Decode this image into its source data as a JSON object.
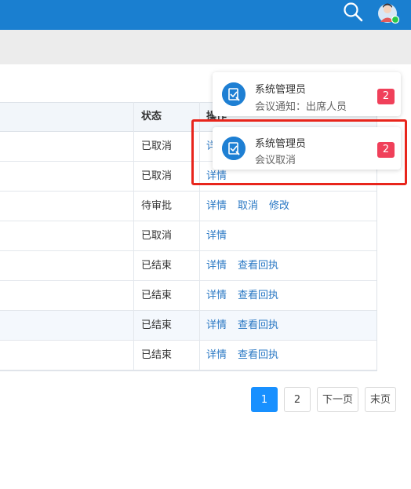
{
  "header": {
    "search_icon": "search-icon",
    "avatar": "user-avatar"
  },
  "table": {
    "headers": {
      "status": "状态",
      "ops": "操作"
    },
    "rows": [
      {
        "status": "已取消",
        "ops": [
          "详情"
        ]
      },
      {
        "status": "已取消",
        "ops": [
          "详情"
        ]
      },
      {
        "status": "待审批",
        "ops": [
          "详情",
          "取消",
          "修改"
        ]
      },
      {
        "status": "已取消",
        "ops": [
          "详情"
        ]
      },
      {
        "status": "已结束",
        "ops": [
          "详情",
          "查看回执"
        ]
      },
      {
        "status": "已结束",
        "ops": [
          "详情",
          "查看回执"
        ]
      },
      {
        "status": "已结束",
        "ops": [
          "详情",
          "查看回执"
        ]
      },
      {
        "status": "已结束",
        "ops": [
          "详情",
          "查看回执"
        ]
      }
    ]
  },
  "pagination": {
    "page1": "1",
    "page2": "2",
    "next": "下一页",
    "last": "末页",
    "current": 1
  },
  "notifications": [
    {
      "title": "系统管理员",
      "desc": "会议通知：出席人员",
      "count": "2"
    },
    {
      "title": "系统管理员",
      "desc": "会议取消",
      "count": "2"
    }
  ],
  "colors": {
    "topbar": "#1a7fd0",
    "accent": "#1890ff",
    "badge": "#f0405a",
    "link": "#2a78c4",
    "highlight_frame": "#e8251c"
  }
}
